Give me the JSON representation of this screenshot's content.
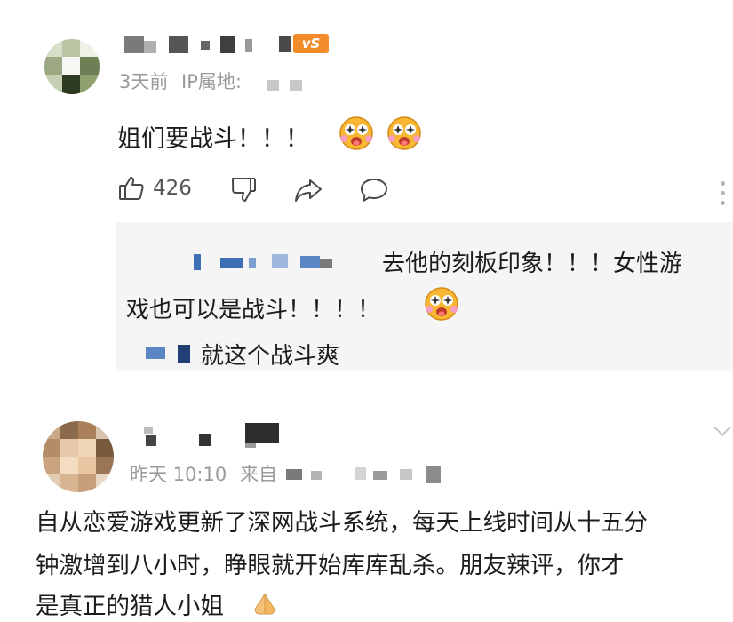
{
  "comment1": {
    "level_badge": "vS",
    "time": "3天前",
    "ip_label": "IP属地:",
    "text": "姐们要战斗！！！",
    "like_count": "426",
    "replies": [
      {
        "text_line1": "去他的刻板印象！！！女性游",
        "text_line2": "戏也可以是战斗！！！！"
      },
      {
        "text": "就这个战斗爽"
      }
    ]
  },
  "comment2": {
    "time": "昨天 10:10",
    "source_label": "来自",
    "text_lines": [
      "自从恋爱游戏更新了深网战斗系统，每天上线时间从十五分",
      "钟激增到八小时，睁眼就开始库库乱杀。朋友辣评，你才",
      "是真正的猎人小姐"
    ]
  },
  "icons": {
    "like": "thumbs-up-icon",
    "dislike": "thumbs-down-icon",
    "share": "share-icon",
    "comment": "comment-icon",
    "more": "more-vertical-icon",
    "emoji": "emoji-starry-eyes-icon",
    "emoji_hand": "emoji-pray-hands-icon"
  },
  "colors": {
    "meta_text": "#9a9a9a",
    "reply_bg": "#f5f5f5",
    "badge": "#f28c2a",
    "mosaic_blue": "#3d6fb5"
  }
}
